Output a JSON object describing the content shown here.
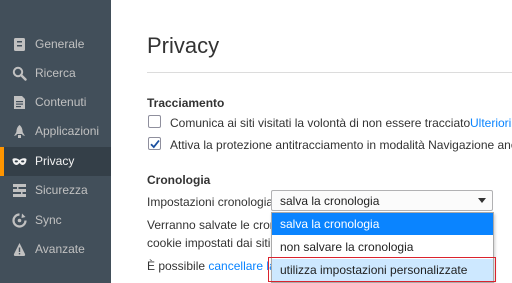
{
  "sidebar": {
    "items": [
      {
        "label": "Generale",
        "icon": "general-icon"
      },
      {
        "label": "Ricerca",
        "icon": "search-icon"
      },
      {
        "label": "Contenuti",
        "icon": "content-icon"
      },
      {
        "label": "Applicazioni",
        "icon": "applications-icon"
      },
      {
        "label": "Privacy",
        "icon": "privacy-mask-icon",
        "selected": true
      },
      {
        "label": "Sicurezza",
        "icon": "security-icon"
      },
      {
        "label": "Sync",
        "icon": "sync-icon"
      },
      {
        "label": "Avanzate",
        "icon": "advanced-icon"
      }
    ]
  },
  "main": {
    "title": "Privacy",
    "tracking": {
      "heading": "Tracciamento",
      "dnt_label": "Comunica ai siti visitati la volontà di non essere tracciato",
      "dnt_link": "Ulteriori",
      "dnt_checked": false,
      "protection_label": "Attiva la protezione antitracciamento in modalità Navigazione anonim",
      "protection_checked": true
    },
    "history": {
      "heading": "Cronologia",
      "settings_label": "Impostazioni cronologia:",
      "selected_value": "salva la cronologia",
      "desc_line1": "Verranno salvate le cronolo",
      "desc_line2": "cookie impostati dai siti w",
      "desc_line3_prefix": "È possibile ",
      "desc_line3_link": "cancellare la c"
    },
    "dropdown_options": [
      "salva la cronologia",
      "non salvare la cronologia",
      "utilizza impostazioni personalizzate"
    ]
  },
  "colors": {
    "sidebar_bg": "#424f5a",
    "sidebar_selected_bg": "#343f48",
    "accent": "#0a84ff",
    "selected_indicator": "#ff9500",
    "highlight_border": "#d9232e"
  }
}
